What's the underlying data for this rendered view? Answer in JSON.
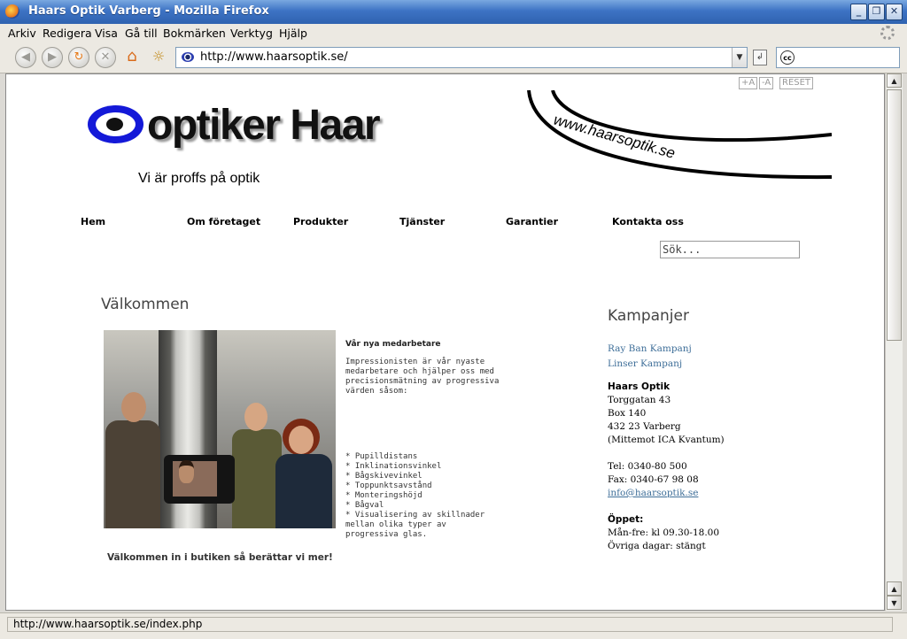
{
  "window": {
    "title": "Haars Optik Varberg - Mozilla Firefox"
  },
  "menu": [
    "Arkiv",
    "Redigera",
    "Visa",
    "Gå till",
    "Bokmärken",
    "Verktyg",
    "Hjälp"
  ],
  "toolbar": {
    "url": "http://www.haarsoptik.se/"
  },
  "page": {
    "font_controls": [
      "+A",
      "-A",
      "RESET"
    ],
    "logo_text": "optiker Haar",
    "slogan": "Vi är proffs på optik",
    "swoosh_text": "www.haarsoptik.se",
    "nav": [
      "Hem",
      "Om företaget",
      "Produkter",
      "Tjänster",
      "Garantier",
      "Kontakta oss"
    ],
    "search_placeholder": "Sök...",
    "welcome_heading": "Välkommen",
    "news": {
      "title": "Vår nya medarbetare",
      "intro": "Impressionisten är vår nyaste medarbetare och hjälper oss med precisionsmätning av progressiva värden såsom:",
      "bullets": [
        "* Pupilldistans",
        "* Inklinationsvinkel",
        "* Bågskivevinkel",
        "* Toppunktsavstånd",
        "* Monteringshöjd",
        "* Bågval",
        "* Visualisering av skillnader mellan olika typer av progressiva glas."
      ]
    },
    "cta": "Välkommen in i butiken så berättar vi mer!",
    "sidebar": {
      "heading": "Kampanjer",
      "links": [
        "Ray Ban Kampanj",
        "Linser Kampanj"
      ],
      "shop_name": "Haars Optik",
      "address": [
        "Torggatan 43",
        "Box 140",
        "432 23 Varberg",
        "(Mittemot ICA Kvantum)"
      ],
      "phone": "Tel: 0340-80 500",
      "fax": "Fax: 0340-67 98 08",
      "email": "info@haarsoptik.se",
      "hours_title": "Öppet:",
      "hours": [
        "Mån-fre: kl 09.30-18.00",
        "Övriga dagar: stängt"
      ]
    }
  },
  "status": {
    "text": "http://www.haarsoptik.se/index.php"
  }
}
